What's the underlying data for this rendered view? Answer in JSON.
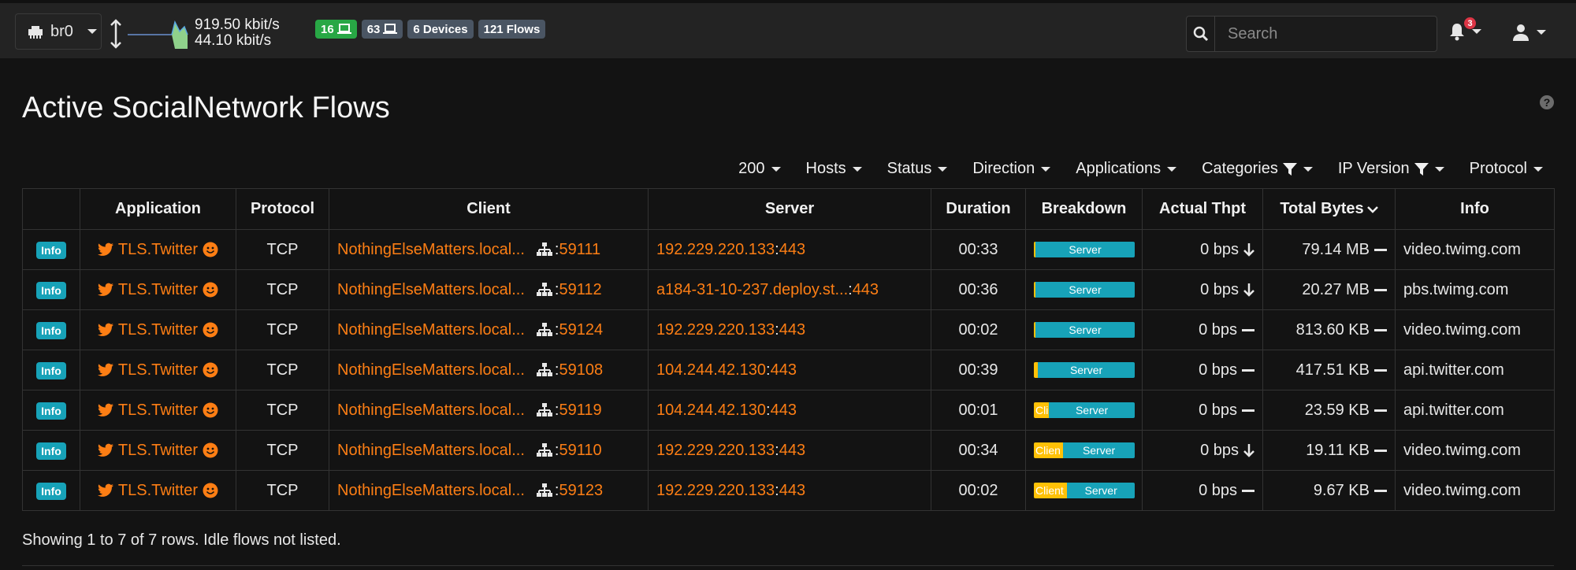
{
  "navbar": {
    "interface": "br0",
    "rate_up": "919.50 kbit/s",
    "rate_down": "44.10 kbit/s",
    "badges": [
      {
        "count": "16",
        "icon": "laptop-icon",
        "color": "#28a745"
      },
      {
        "count": "63",
        "icon": "laptop-icon",
        "color": "#4a5563"
      },
      {
        "label": "6 Devices",
        "color": "#4a5563"
      },
      {
        "label": "121 Flows",
        "color": "#4a5563"
      }
    ],
    "search_placeholder": "Search",
    "notification_count": "3"
  },
  "page": {
    "title": "Active SocialNetwork Flows"
  },
  "filters": {
    "page_size": "200",
    "hosts": "Hosts",
    "status": "Status",
    "direction": "Direction",
    "applications": "Applications",
    "categories": "Categories",
    "ip_version": "IP Version",
    "protocol": "Protocol"
  },
  "table": {
    "headers": {
      "application": "Application",
      "protocol": "Protocol",
      "client": "Client",
      "server": "Server",
      "duration": "Duration",
      "breakdown": "Breakdown",
      "actual_thpt": "Actual Thpt",
      "total_bytes": "Total Bytes",
      "info": "Info"
    },
    "info_label": "Info",
    "rows": [
      {
        "app": "TLS.Twitter",
        "proto": "TCP",
        "client": "NothingElseMatters.local...",
        "client_port": "59111",
        "server": "192.229.220.133",
        "server_port": "443",
        "duration": "00:33",
        "client_label": "",
        "client_pct": 1,
        "server_label": "Server",
        "thpt": "0 bps",
        "thpt_trend": "down",
        "bytes": "79.14 MB",
        "info": "video.twimg.com"
      },
      {
        "app": "TLS.Twitter",
        "proto": "TCP",
        "client": "NothingElseMatters.local...",
        "client_port": "59112",
        "server": "a184-31-10-237.deploy.st...",
        "server_port": "443",
        "duration": "00:36",
        "client_label": "",
        "client_pct": 1,
        "server_label": "Server",
        "thpt": "0 bps",
        "thpt_trend": "down",
        "bytes": "20.27 MB",
        "info": "pbs.twimg.com"
      },
      {
        "app": "TLS.Twitter",
        "proto": "TCP",
        "client": "NothingElseMatters.local...",
        "client_port": "59124",
        "server": "192.229.220.133",
        "server_port": "443",
        "duration": "00:02",
        "client_label": "",
        "client_pct": 1,
        "server_label": "Server",
        "thpt": "0 bps",
        "thpt_trend": "flat",
        "bytes": "813.60 KB",
        "info": "video.twimg.com"
      },
      {
        "app": "TLS.Twitter",
        "proto": "TCP",
        "client": "NothingElseMatters.local...",
        "client_port": "59108",
        "server": "104.244.42.130",
        "server_port": "443",
        "duration": "00:39",
        "client_label": "",
        "client_pct": 4,
        "server_label": "Server",
        "thpt": "0 bps",
        "thpt_trend": "flat",
        "bytes": "417.51 KB",
        "info": "api.twitter.com"
      },
      {
        "app": "TLS.Twitter",
        "proto": "TCP",
        "client": "NothingElseMatters.local...",
        "client_port": "59119",
        "server": "104.244.42.130",
        "server_port": "443",
        "duration": "00:01",
        "client_label": "Cli",
        "client_pct": 15,
        "server_label": "Server",
        "thpt": "0 bps",
        "thpt_trend": "flat",
        "bytes": "23.59 KB",
        "info": "api.twitter.com"
      },
      {
        "app": "TLS.Twitter",
        "proto": "TCP",
        "client": "NothingElseMatters.local...",
        "client_port": "59110",
        "server": "192.229.220.133",
        "server_port": "443",
        "duration": "00:34",
        "client_label": "Clien",
        "client_pct": 29,
        "server_label": "Server",
        "thpt": "0 bps",
        "thpt_trend": "down",
        "bytes": "19.11 KB",
        "info": "video.twimg.com"
      },
      {
        "app": "TLS.Twitter",
        "proto": "TCP",
        "client": "NothingElseMatters.local...",
        "client_port": "59123",
        "server": "192.229.220.133",
        "server_port": "443",
        "duration": "00:02",
        "client_label": "Client",
        "client_pct": 33,
        "server_label": "Server",
        "thpt": "0 bps",
        "thpt_trend": "flat",
        "bytes": "9.67 KB",
        "info": "video.twimg.com"
      }
    ]
  },
  "footer": {
    "status": "Showing 1 to 7 of 7 rows. Idle flows not listed."
  },
  "colors": {
    "accent_orange": "#fd7e14",
    "info_teal": "#17a2b8",
    "client_yellow": "#ffc107"
  }
}
